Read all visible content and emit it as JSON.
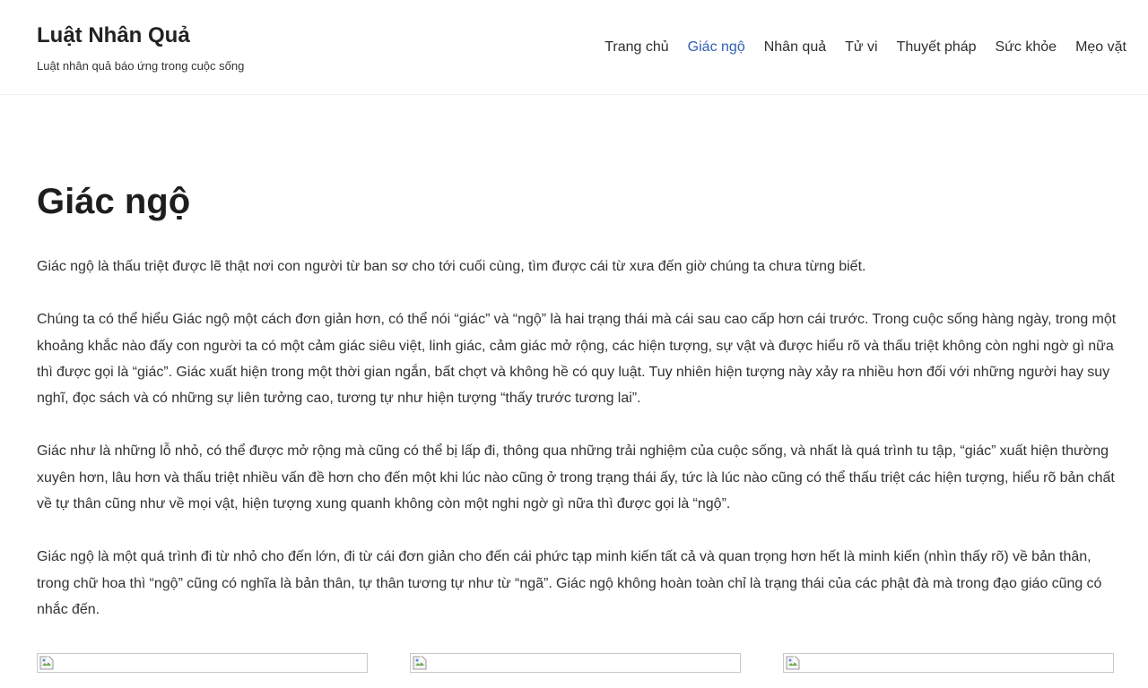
{
  "site": {
    "title": "Luật Nhân Quả",
    "tagline": "Luật nhân quả báo ứng trong cuộc sống"
  },
  "nav": {
    "items": [
      {
        "label": "Trang chủ",
        "active": false
      },
      {
        "label": "Giác ngộ",
        "active": true
      },
      {
        "label": "Nhân quả",
        "active": false
      },
      {
        "label": "Tử vi",
        "active": false
      },
      {
        "label": "Thuyết pháp",
        "active": false
      },
      {
        "label": "Sức khỏe",
        "active": false
      },
      {
        "label": "Mẹo vặt",
        "active": false
      }
    ]
  },
  "article": {
    "title": "Giác ngộ",
    "paragraphs": [
      "Giác ngộ là thấu triệt được lẽ thật nơi con người từ ban sơ cho tới cuối cùng, tìm được cái từ xưa đến giờ chúng ta chưa từng biết.",
      "Chúng ta có thể hiểu Giác ngộ một cách đơn giản hơn, có thể nói “giác” và “ngộ” là hai trạng thái mà cái sau cao cấp hơn cái trước. Trong cuộc sống hàng ngày, trong một khoảng khắc nào đấy con người ta có một cảm giác siêu việt, linh giác, cảm giác mở rộng, các hiện tượng, sự vật và được hiểu rõ và thấu triệt không còn nghi ngờ gì nữa thì được gọi là “giác”. Giác xuất hiện trong một thời gian ngắn, bất chợt và không hề có quy luật. Tuy nhiên hiện tượng này xảy ra nhiều hơn đối với những người hay suy nghĩ, đọc sách và có những sự liên tưởng cao, tương tự như hiện tượng “thấy trước tương lai”.",
      "Giác như là những lỗ nhỏ, có thể được mở rộng mà cũng có thể bị lấp đi, thông qua những trải nghiệm của cuộc sống, và nhất là quá trình tu tập, “giác” xuất hiện thường xuyên hơn, lâu hơn và thấu triệt nhiều vấn đề hơn cho đến một khi lúc nào cũng ở trong trạng thái ấy, tức là lúc nào cũng có thể thấu triệt các hiện tượng, hiểu rõ bản chất về tự thân cũng như về mọi vật, hiện tượng xung quanh không còn một nghi ngờ gì nữa thì được gọi là “ngộ”.",
      "Giác ngộ là một quá trình đi từ nhỏ cho đến lớn, đi từ cái đơn giản cho đến cái phức tạp minh kiến tất cả và quan trọng hơn hết là minh kiến (nhìn thấy rõ) về bản thân, trong chữ hoa thì “ngộ” cũng có nghĩa là bản thân, tự thân tương tự như từ “ngã”. Giác ngộ không hoàn toàn chỉ là trạng thái của các phật đà mà trong đạo giáo cũng có nhắc đến."
    ]
  },
  "gallery": {
    "images": [
      {
        "icon": "broken-image-icon"
      },
      {
        "icon": "broken-image-icon"
      },
      {
        "icon": "broken-image-icon"
      }
    ]
  },
  "colors": {
    "accent": "#2f5fb3",
    "text": "#333333",
    "heading": "#1e1e1e"
  }
}
